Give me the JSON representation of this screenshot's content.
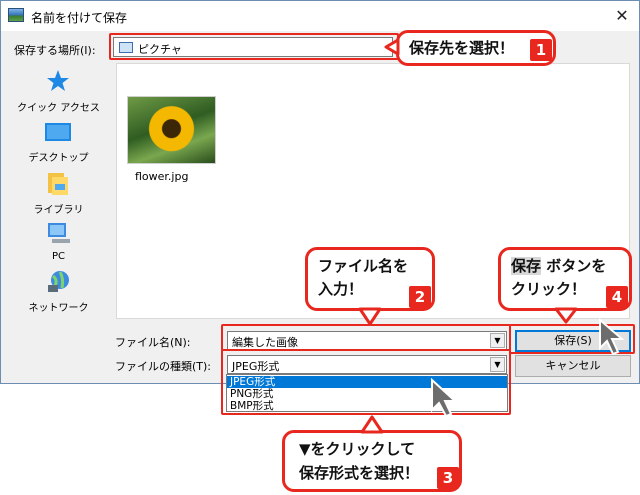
{
  "window": {
    "title": "名前を付けて保存",
    "close_label": "✕"
  },
  "location": {
    "label": "保存する場所(I):",
    "value": "ピクチャ"
  },
  "sidebar": {
    "items": [
      {
        "label": "クイック アクセス",
        "icon": "star-icon"
      },
      {
        "label": "デスクトップ",
        "icon": "desktop-icon"
      },
      {
        "label": "ライブラリ",
        "icon": "library-icon"
      },
      {
        "label": "PC",
        "icon": "pc-icon"
      },
      {
        "label": "ネットワーク",
        "icon": "network-icon"
      }
    ]
  },
  "files": [
    {
      "name": "flower.jpg",
      "icon": "sunflower-thumbnail"
    }
  ],
  "filename": {
    "label": "ファイル名(N):",
    "value": "編集した画像"
  },
  "filetype": {
    "label": "ファイルの種類(T):",
    "value": "JPEG形式",
    "options": [
      "JPEG形式",
      "PNG形式",
      "BMP形式"
    ]
  },
  "buttons": {
    "save": "保存(S)",
    "cancel": "キャンセル"
  },
  "callouts": {
    "c1": {
      "line1": "保存先を選択！",
      "badge": "1"
    },
    "c2": {
      "line1": "ファイル名を",
      "line2": "入力！",
      "badge": "2"
    },
    "c3": {
      "line1": "▼をクリックして",
      "line2": "保存形式を選択！",
      "badge": "3"
    },
    "c4": {
      "line1_hl": "保存",
      "line1_rest": " ボタンを",
      "line2": "クリック！",
      "badge": "4"
    }
  },
  "colors": {
    "accent": "#e8281f",
    "selection": "#0078d7",
    "dialog_bg": "#f0f0f0"
  }
}
